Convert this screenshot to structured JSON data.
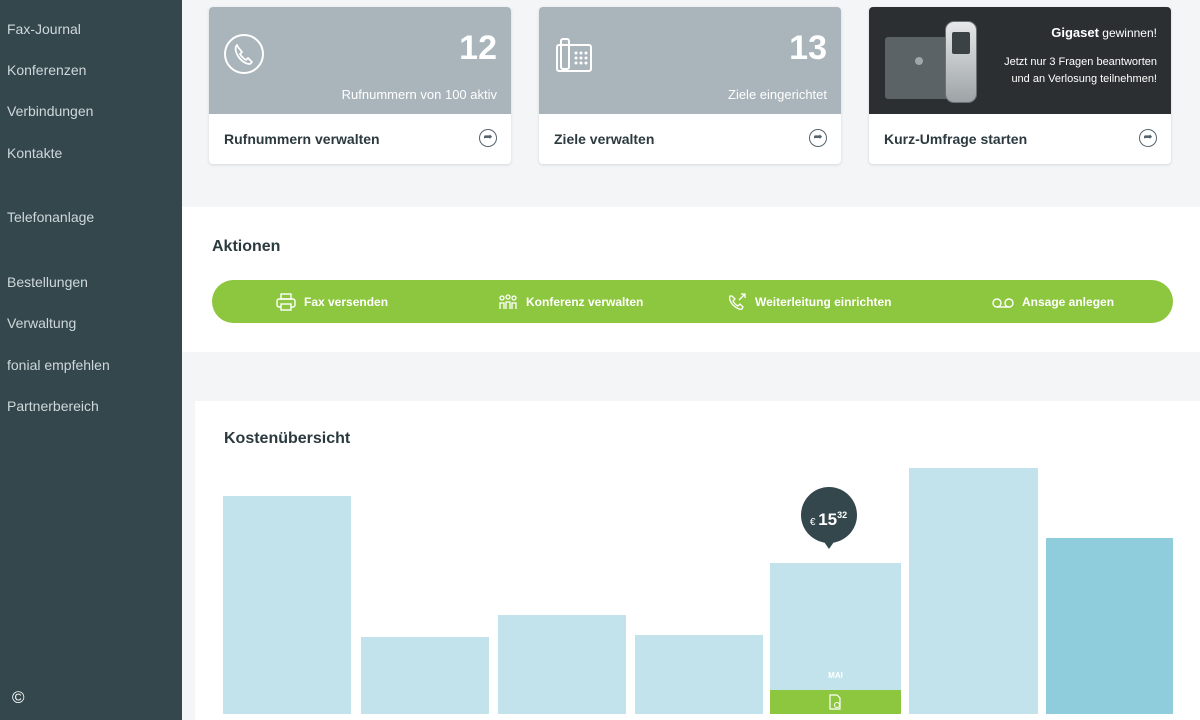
{
  "sidebar": {
    "items": [
      {
        "label": "Fax-Journal"
      },
      {
        "label": "Konferenzen"
      },
      {
        "label": "Verbindungen"
      },
      {
        "label": "Kontakte"
      },
      {
        "label": "Telefonanlage"
      },
      {
        "label": "Bestellungen"
      },
      {
        "label": "Verwaltung"
      },
      {
        "label": "fonial empfehlen"
      },
      {
        "label": "Partnerbereich"
      }
    ],
    "copyright": "©"
  },
  "cards": {
    "numbers": {
      "count": "12",
      "subtitle": "Rufnummern von 100 aktiv",
      "label": "Rufnummern verwalten",
      "icon": "phone-circle-icon"
    },
    "targets": {
      "count": "13",
      "subtitle": "Ziele eingerichtet",
      "label": "Ziele verwalten",
      "icon": "desk-phone-icon"
    },
    "promo": {
      "brand": "Gigaset",
      "brand_suffix": "gewinnen!",
      "text": "Jetzt nur 3 Fragen beantworten und an Verlosung teilnehmen!",
      "label": "Kurz-Umfrage starten"
    }
  },
  "actions": {
    "title": "Aktionen",
    "buttons": [
      {
        "label": "Fax versenden",
        "icon": "fax-icon"
      },
      {
        "label": "Konferenz verwalten",
        "icon": "conference-icon"
      },
      {
        "label": "Weiterleitung einrichten",
        "icon": "forward-call-icon"
      },
      {
        "label": "Ansage anlegen",
        "icon": "voicemail-icon"
      }
    ],
    "accent_color": "#8dc63f"
  },
  "costs": {
    "title": "Kostenübersicht",
    "selected_month": "MAI",
    "tooltip_currency": "€",
    "tooltip_euros": "15",
    "tooltip_cents": "32",
    "colors": {
      "bar": "#c2e3ec",
      "bar_current": "#8fccdc",
      "tooltip": "#34474d"
    }
  },
  "chart_data": {
    "type": "bar",
    "categories": [
      "",
      "",
      "",
      "",
      "MAI",
      "",
      ""
    ],
    "values": [
      null,
      null,
      null,
      null,
      15.32,
      null,
      null
    ],
    "relative_heights": [
      0.88,
      0.31,
      0.4,
      0.32,
      0.61,
      0.99,
      0.71
    ],
    "title": "Kostenübersicht"
  }
}
